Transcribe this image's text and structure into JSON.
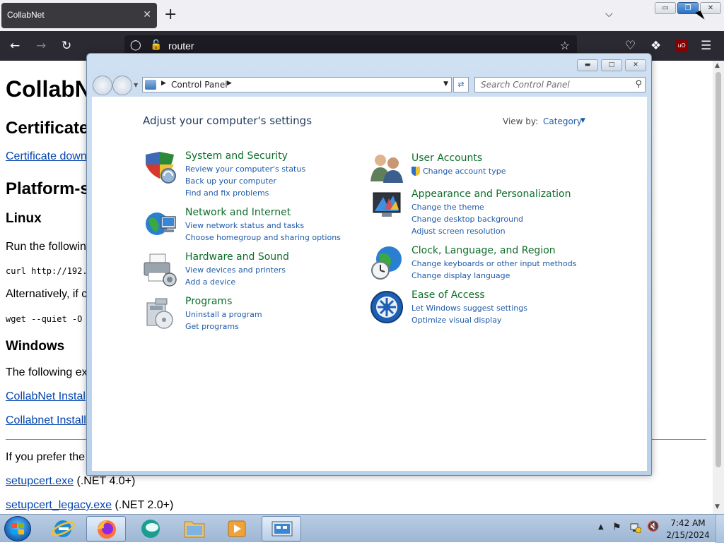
{
  "browser": {
    "tab_title": "CollabNet",
    "tab_close": "✕",
    "new_tab": "+",
    "tab_list": "⌵",
    "url": "router",
    "window_buttons": {
      "minimize": "▭",
      "restore": "❐",
      "close": "✕"
    }
  },
  "webpage": {
    "h1": "CollabN",
    "h2_certificate": "Certificate",
    "link_certificate": "Certificate down",
    "h2_platform": "Platform-s",
    "h3_linux": "Linux",
    "p_run": "Run the followin",
    "code_curl": "curl http://192.:",
    "p_alt": "Alternatively, if c",
    "code_wget": "wget --quiet -O",
    "h3_windows": "Windows",
    "p_following": "The following ex",
    "link_installer1": "CollabNet Instal",
    "link_installer2": "Collabnet Install",
    "p_prefer": "If you prefer the",
    "link_setupcert": "setupcert.exe",
    "setupcert_note": " (.NET 4.0+)",
    "link_setupcert_legacy": "setupcert_legacy.exe",
    "setupcert_legacy_note": " (.NET 2.0+)"
  },
  "control_panel": {
    "address": "Control Panel",
    "search_placeholder": "Search Control Panel",
    "heading": "Adjust your computer's settings",
    "view_by_label": "View by:",
    "view_by_value": "Category",
    "categories_left": [
      {
        "title": "System and Security",
        "links": [
          "Review your computer's status",
          "Back up your computer",
          "Find and fix problems"
        ]
      },
      {
        "title": "Network and Internet",
        "links": [
          "View network status and tasks",
          "Choose homegroup and sharing options"
        ]
      },
      {
        "title": "Hardware and Sound",
        "links": [
          "View devices and printers",
          "Add a device"
        ]
      },
      {
        "title": "Programs",
        "links": [
          "Uninstall a program",
          "Get programs"
        ]
      }
    ],
    "categories_right": [
      {
        "title": "User Accounts",
        "links": [
          "Change account type"
        ]
      },
      {
        "title": "Appearance and Personalization",
        "links": [
          "Change the theme",
          "Change desktop background",
          "Adjust screen resolution"
        ]
      },
      {
        "title": "Clock, Language, and Region",
        "links": [
          "Change keyboards or other input methods",
          "Change display language"
        ]
      },
      {
        "title": "Ease of Access",
        "links": [
          "Let Windows suggest settings",
          "Optimize visual display"
        ]
      }
    ]
  },
  "taskbar": {
    "time": "7:42 AM",
    "date": "2/15/2024",
    "apps": [
      "internet-explorer",
      "firefox",
      "chat-app",
      "file-explorer",
      "media-player",
      "control-panel"
    ]
  }
}
